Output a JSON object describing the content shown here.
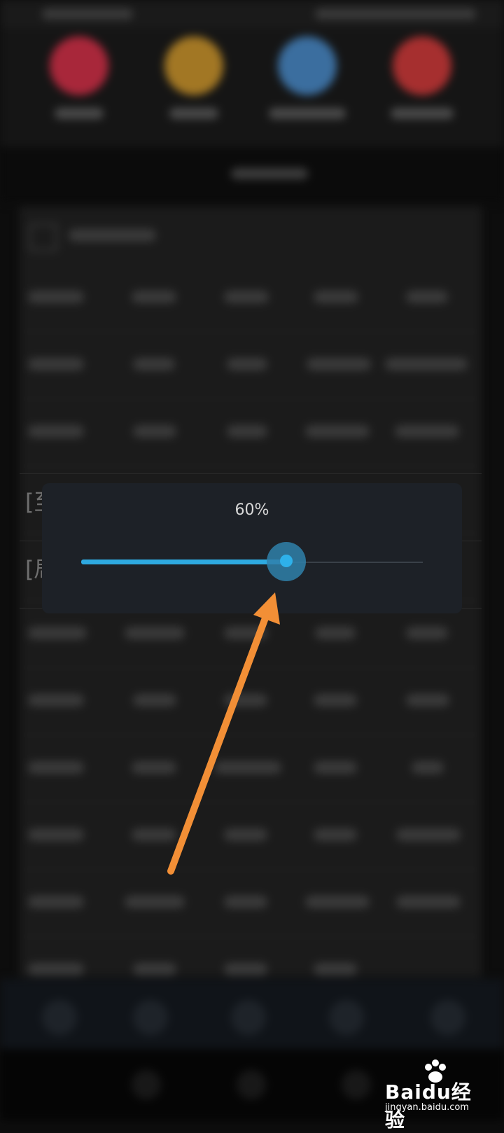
{
  "slider": {
    "percent_label": "60%",
    "value": 0.6,
    "fill_color": "#2ea9e0",
    "thumb_color": "#2eb1ea"
  },
  "partial_labels": {
    "row_a": "[至",
    "row_b": "[局"
  },
  "annotation": {
    "arrow_color": "#f28f36",
    "points_to": "slider-thumb"
  },
  "watermark": {
    "logo_text": "Baidu经验",
    "url": "jingyan.baidu.com"
  },
  "tool_colors": [
    "#a8273a",
    "#a27724",
    "#3b6e9f",
    "#a62f2f"
  ]
}
